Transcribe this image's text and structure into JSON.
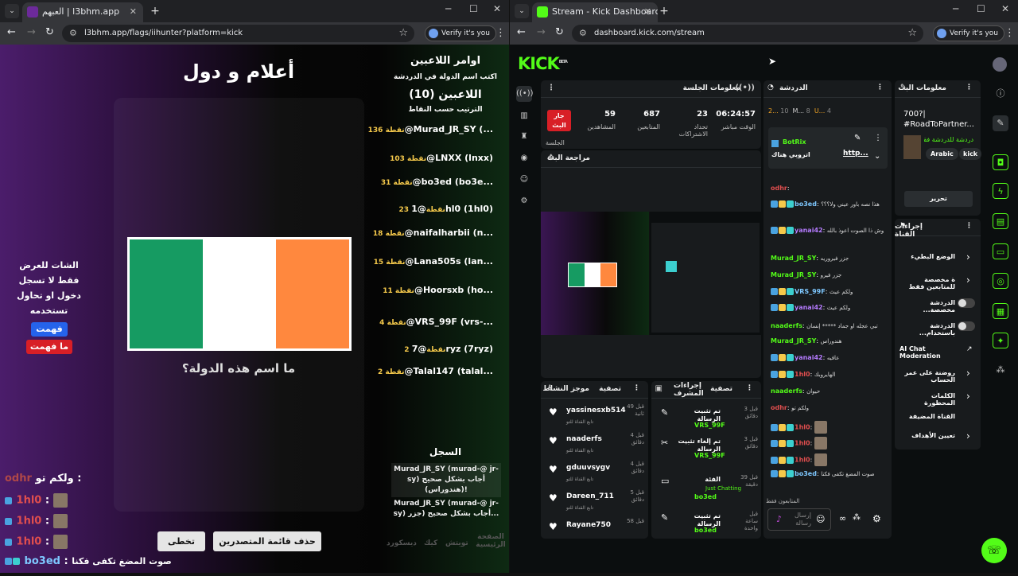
{
  "left_window": {
    "tab_title": "العبهم | l3bhm.app",
    "url": "l3bhm.app/flags/iihunter?platform=kick",
    "verify_label": "Verify it's you",
    "page": {
      "game_title": "أعلام و دول",
      "question": "ما اسم هذه الدولة؟",
      "flag_colors": [
        "#169b62",
        "#ffffff",
        "#ff883e"
      ],
      "notice": "الشات للعرض فقط لا تسجل دخول او تحاول تستخدمه",
      "understood_button": "فهمت",
      "not_understood_button": "ما فهمت",
      "commands_title": "اوامر اللاعبين",
      "commands_sub": "اكتب اسم الدولة في الدردشة",
      "players_title": "اللاعبين (10)",
      "sort_label": "الترتيب حسب النقاط",
      "players": [
        {
          "name": "@Murad_JR_SY (...",
          "points": "136 نقطة"
        },
        {
          "name": "@LNXX (lnxx)",
          "points": "103 نقطة"
        },
        {
          "name": "@bo3ed (bo3e...",
          "points": "31 نقطة"
        },
        {
          "name": "@1hl0 (1hl0)",
          "points": "23 نقطة"
        },
        {
          "name": "@naifalharbii (n...",
          "points": "18 نقطة"
        },
        {
          "name": "@Lana505s (lan...",
          "points": "15 نقطة"
        },
        {
          "name": "@Hoorsxb (ho...",
          "points": "11 نقطة"
        },
        {
          "name": "@VRS_99F (vrs-...",
          "points": "4 نقطة"
        },
        {
          "name": "@7ryz (7ryz)",
          "points": "2 نقطة"
        },
        {
          "name": "@Talal147 (talal...",
          "points": "2 نقطة"
        }
      ],
      "log_title": "السجل",
      "log_entries": [
        "Murad_JR_SY (murad-@ jr-sy) أجاب بشكل صحيح (هندوراس)!",
        "Murad_JR_SY (murad-@ jr-sy) أجاب بشكل صحيح (جزر..."
      ],
      "skip_button": "تخطى",
      "delete_leaderboard_button": "حذف قائمة المتصدرين",
      "footer_links": [
        "الصفحة الرئيسية",
        "تويتش",
        "كيك",
        "ديسكورد"
      ],
      "chat": [
        {
          "user": "odhr",
          "text": "ولكم تو"
        },
        {
          "user": "1hl0",
          "text": ""
        },
        {
          "user": "1hl0",
          "text": ""
        },
        {
          "user": "1hl0",
          "text": ""
        },
        {
          "user": "bo3ed",
          "text": "صوت المضغ تكفى فكنا"
        }
      ]
    }
  },
  "right_window": {
    "tab_title": "Stream - Kick Dashboard",
    "url": "dashboard.kick.com/stream",
    "verify_label": "Verify it's you",
    "logo": "KICK",
    "logo_tag": "BETA",
    "session": {
      "title": "معلومات الجلسة",
      "live_badge": "جار البث",
      "session_label": "الجلسة",
      "stats": [
        {
          "value": "06:24:57",
          "label": "الوقت مباشر"
        },
        {
          "value": "23",
          "label": "تحداد الاشتراكات"
        },
        {
          "value": "687",
          "label": "المتابعين"
        },
        {
          "value": "59",
          "label": "المشاهدين"
        }
      ]
    },
    "preview": {
      "title": "مراجعة البث"
    },
    "activity": {
      "title": "موجز النشاط",
      "filter": "تصفية",
      "items": [
        {
          "user": "yassinesxb514",
          "sub": "تابع القناة للتو",
          "time": "قبل 49 ثانية"
        },
        {
          "user": "naaderfs",
          "sub": "تابع القناة للتو",
          "time": "قبل 4 دقائق"
        },
        {
          "user": "gduuvsygv",
          "sub": "تابع القناة للتو",
          "time": "قبل 4 دقائق"
        },
        {
          "user": "Dareen_711",
          "sub": "تابع القناة للتو",
          "time": "قبل 5 دقائق"
        },
        {
          "user": "Rayane750",
          "sub": "",
          "time": "قبل 58"
        }
      ]
    },
    "mod_actions": {
      "title": "إجراءات المشرف",
      "filter": "تصفية",
      "items": [
        {
          "title": "تم تثبيت الرسالة",
          "by": "VRS_99F",
          "time": "قبل 3 دقائق"
        },
        {
          "title": "تم إلغاء تثبيت الرسالة",
          "by": "VRS_99F",
          "time": "قبل 3 دقائق"
        },
        {
          "title": "الفئة",
          "by": "bo3ed",
          "detail": "Just Chatting",
          "time": "قبل 39 دقيقة"
        },
        {
          "title": "تم تثبيت الرسالة",
          "by": "bo3ed",
          "time": "قبل ساعة واحدة"
        }
      ]
    },
    "chat": {
      "title": "الدردشة",
      "counts": [
        "2...",
        "10",
        "M...",
        "8",
        "U...",
        "4"
      ],
      "pinned_user": "BotRix",
      "pinned_text": "اتروبي هناك",
      "pinned_link": "http...",
      "messages": [
        {
          "user": "odhr",
          "color": "#e04e4e",
          "text": ""
        },
        {
          "user": "bo3ed",
          "color": "#7ec8ff",
          "text": "هذا نصه باور عيني ولا؟؟؟"
        },
        {
          "user": "yanai42",
          "color": "#b57bff",
          "text": "وش ذا الصوت اعوذ بالله"
        },
        {
          "user": "Murad_JR_SY",
          "color": "#53fc18",
          "text": "جزر فيروريه"
        },
        {
          "user": "Murad_JR_SY",
          "color": "#53fc18",
          "text": "جزر فيرو"
        },
        {
          "user": "VRS_99F",
          "color": "#7ec8ff",
          "text": "ولكم عيث"
        },
        {
          "user": "yanai42",
          "color": "#b57bff",
          "text": "ولكم عيث"
        },
        {
          "user": "naaderfs",
          "color": "#53fc18",
          "text": "تبي عجله او جماد ***** إنسان"
        },
        {
          "user": "Murad_JR_SY",
          "color": "#53fc18",
          "text": "هندوراس"
        },
        {
          "user": "yanai42",
          "color": "#b57bff",
          "text": "عافيه"
        },
        {
          "user": "1hl0",
          "color": "#e04e4e",
          "text": "الهايروبك"
        },
        {
          "user": "naaderfs",
          "color": "#53fc18",
          "text": "حيوان"
        },
        {
          "user": "odhr",
          "color": "#e04e4e",
          "text": "ولكم تو"
        },
        {
          "user": "1hl0",
          "color": "#e04e4e",
          "text": ""
        },
        {
          "user": "1hl0",
          "color": "#e04e4e",
          "text": ""
        },
        {
          "user": "1hl0",
          "color": "#e04e4e",
          "text": ""
        },
        {
          "user": "bo3ed",
          "color": "#7ec8ff",
          "text": "صوت المضغ تكفى فكنا"
        }
      ],
      "followers_only": "المتابعون فقط",
      "input_placeholder": "إرسال رسالة"
    },
    "stream_info": {
      "title": "معلومات البث",
      "stream_title": "700?| #RoadToPartner...",
      "category": "دردشة للدردشة فقط",
      "tags": [
        "Arabic",
        "kick"
      ],
      "edit_button": "تحرير"
    },
    "channel_actions": {
      "title": "إجراءات القناة",
      "items": [
        {
          "label": "الوضع البطيء",
          "type": "chevron"
        },
        {
          "label": "ة مخصصة للمتابعين فقط",
          "type": "chevron"
        },
        {
          "label": "الدردشة مخصصة...",
          "type": "toggle"
        },
        {
          "label": "الدردشة باستخدام...",
          "type": "toggle"
        },
        {
          "label": "AI Chat Moderation",
          "type": "external"
        },
        {
          "label": "روضنة على عمر الحساب",
          "type": "chevron"
        },
        {
          "label": "الكلمات المحظورة",
          "type": "chevron"
        },
        {
          "label": "القناة المضيفة",
          "type": "none"
        },
        {
          "label": "تعيين الأهداف",
          "type": "chevron"
        }
      ]
    },
    "accent": "#53fc18"
  }
}
